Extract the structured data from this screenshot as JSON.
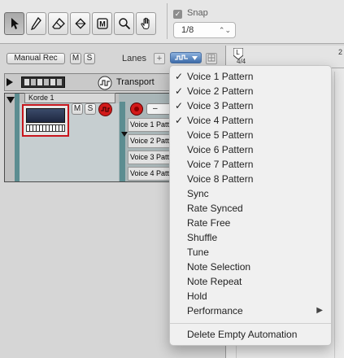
{
  "toolbar": {
    "tools": [
      {
        "name": "select-arrow-icon",
        "active": true
      },
      {
        "name": "pencil-icon",
        "active": false
      },
      {
        "name": "eraser-icon",
        "active": false
      },
      {
        "name": "razor-icon",
        "active": false
      },
      {
        "name": "mute-tool-icon",
        "active": false
      },
      {
        "name": "magnify-icon",
        "active": false
      },
      {
        "name": "hand-icon",
        "active": false
      }
    ],
    "snap_label": "Snap",
    "snap_checked": true,
    "snap_value": "1/8"
  },
  "header": {
    "manual_rec": "Manual Rec",
    "mute": "M",
    "solo": "S",
    "lanes_label": "Lanes",
    "add_lane": "+"
  },
  "tracks": {
    "transport_name": "Transport",
    "korde_name": "Korde 1",
    "mute": "M",
    "solo": "S",
    "lane_names": [
      "Voice 1 Patt",
      "Voice 2 Patt",
      "Voice 3 Patt",
      "Voice 4 Patt"
    ],
    "lane_menu_value": "–"
  },
  "ruler": {
    "bar_1": "1",
    "bar_2": "2",
    "time_sig": "4/4"
  },
  "menu": {
    "items": [
      {
        "label": "Voice 1 Pattern",
        "checked": "✓"
      },
      {
        "label": "Voice 2 Pattern",
        "checked": "✓"
      },
      {
        "label": "Voice 3 Pattern",
        "checked": "✓"
      },
      {
        "label": "Voice 4 Pattern",
        "checked": "✓"
      },
      {
        "label": "Voice 5 Pattern",
        "checked": ""
      },
      {
        "label": "Voice 6 Pattern",
        "checked": ""
      },
      {
        "label": "Voice 7 Pattern",
        "checked": ""
      },
      {
        "label": "Voice 8 Pattern",
        "checked": ""
      },
      {
        "label": "Sync",
        "checked": ""
      },
      {
        "label": "Rate Synced",
        "checked": ""
      },
      {
        "label": "Rate Free",
        "checked": ""
      },
      {
        "label": "Shuffle",
        "checked": ""
      },
      {
        "label": "Tune",
        "checked": ""
      },
      {
        "label": "Note Selection",
        "checked": ""
      },
      {
        "label": "Note Repeat",
        "checked": ""
      },
      {
        "label": "Hold",
        "checked": ""
      },
      {
        "label": "Performance",
        "checked": "",
        "submenu": "▶"
      },
      {
        "label": "Delete Empty Automation",
        "checked": ""
      }
    ]
  },
  "colors": {
    "accent_blue": "#3f6fae",
    "record_red": "#d21a1a",
    "device_red_border": "#c8161d",
    "track_teal": "#5c8d91"
  }
}
